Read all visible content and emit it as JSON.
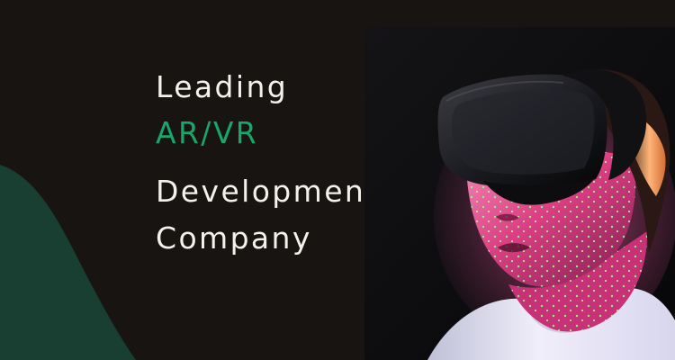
{
  "headline": {
    "line1": "Leading",
    "line2": "AR/VR",
    "line3": "Development",
    "line4": "Company"
  },
  "colors": {
    "background": "#181411",
    "text": "#f4f1ec",
    "accent": "#19a66a",
    "shape": "#183f31"
  },
  "icons": {
    "photo": "vr-headset-portrait"
  }
}
